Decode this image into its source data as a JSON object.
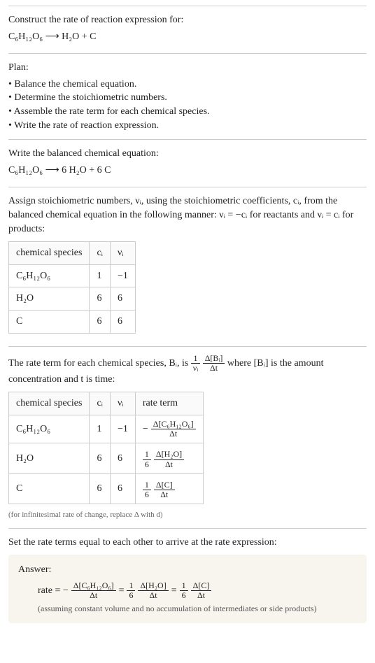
{
  "intro": {
    "line1": "Construct the rate of reaction expression for:",
    "eq": "C₆H₁₂O₆  ⟶  H₂O + C"
  },
  "plan": {
    "heading": "Plan:",
    "items": [
      "Balance the chemical equation.",
      "Determine the stoichiometric numbers.",
      "Assemble the rate term for each chemical species.",
      "Write the rate of reaction expression."
    ]
  },
  "balanced": {
    "heading": "Write the balanced chemical equation:",
    "eq": "C₆H₁₂O₆  ⟶  6 H₂O + 6 C"
  },
  "stoich": {
    "text": "Assign stoichiometric numbers, νᵢ, using the stoichiometric coefficients, cᵢ, from the balanced chemical equation in the following manner: νᵢ = −cᵢ for reactants and νᵢ = cᵢ for products:",
    "headers": {
      "species": "chemical species",
      "c": "cᵢ",
      "v": "νᵢ"
    },
    "rows": [
      {
        "species": "C₆H₁₂O₆",
        "c": "1",
        "v": "−1"
      },
      {
        "species": "H₂O",
        "c": "6",
        "v": "6"
      },
      {
        "species": "C",
        "c": "6",
        "v": "6"
      }
    ]
  },
  "rateterm": {
    "text_a": "The rate term for each chemical species, Bᵢ, is ",
    "text_b": " where [Bᵢ] is the amount concentration and t is time:",
    "frac1": {
      "num": "1",
      "den": "νᵢ"
    },
    "frac2": {
      "num": "Δ[Bᵢ]",
      "den": "Δt"
    },
    "headers": {
      "species": "chemical species",
      "c": "cᵢ",
      "v": "νᵢ",
      "rt": "rate term"
    },
    "rows": [
      {
        "species": "C₆H₁₂O₆",
        "c": "1",
        "v": "−1",
        "pre": "− ",
        "num": "Δ[C₆H₁₂O₆]",
        "den": "Δt"
      },
      {
        "species": "H₂O",
        "c": "6",
        "v": "6",
        "pre1n": "1",
        "pre1d": "6",
        "num": "Δ[H₂O]",
        "den": "Δt"
      },
      {
        "species": "C",
        "c": "6",
        "v": "6",
        "pre1n": "1",
        "pre1d": "6",
        "num": "Δ[C]",
        "den": "Δt"
      }
    ],
    "foot": "(for infinitesimal rate of change, replace Δ with d)"
  },
  "final": {
    "intro": "Set the rate terms equal to each other to arrive at the rate expression:",
    "label": "Answer:",
    "rate": "rate = − ",
    "t1": {
      "num": "Δ[C₆H₁₂O₆]",
      "den": "Δt"
    },
    "eq": " = ",
    "onesix": {
      "num": "1",
      "den": "6"
    },
    "t2": {
      "num": "Δ[H₂O]",
      "den": "Δt"
    },
    "t3": {
      "num": "Δ[C]",
      "den": "Δt"
    },
    "note": "(assuming constant volume and no accumulation of intermediates or side products)"
  }
}
